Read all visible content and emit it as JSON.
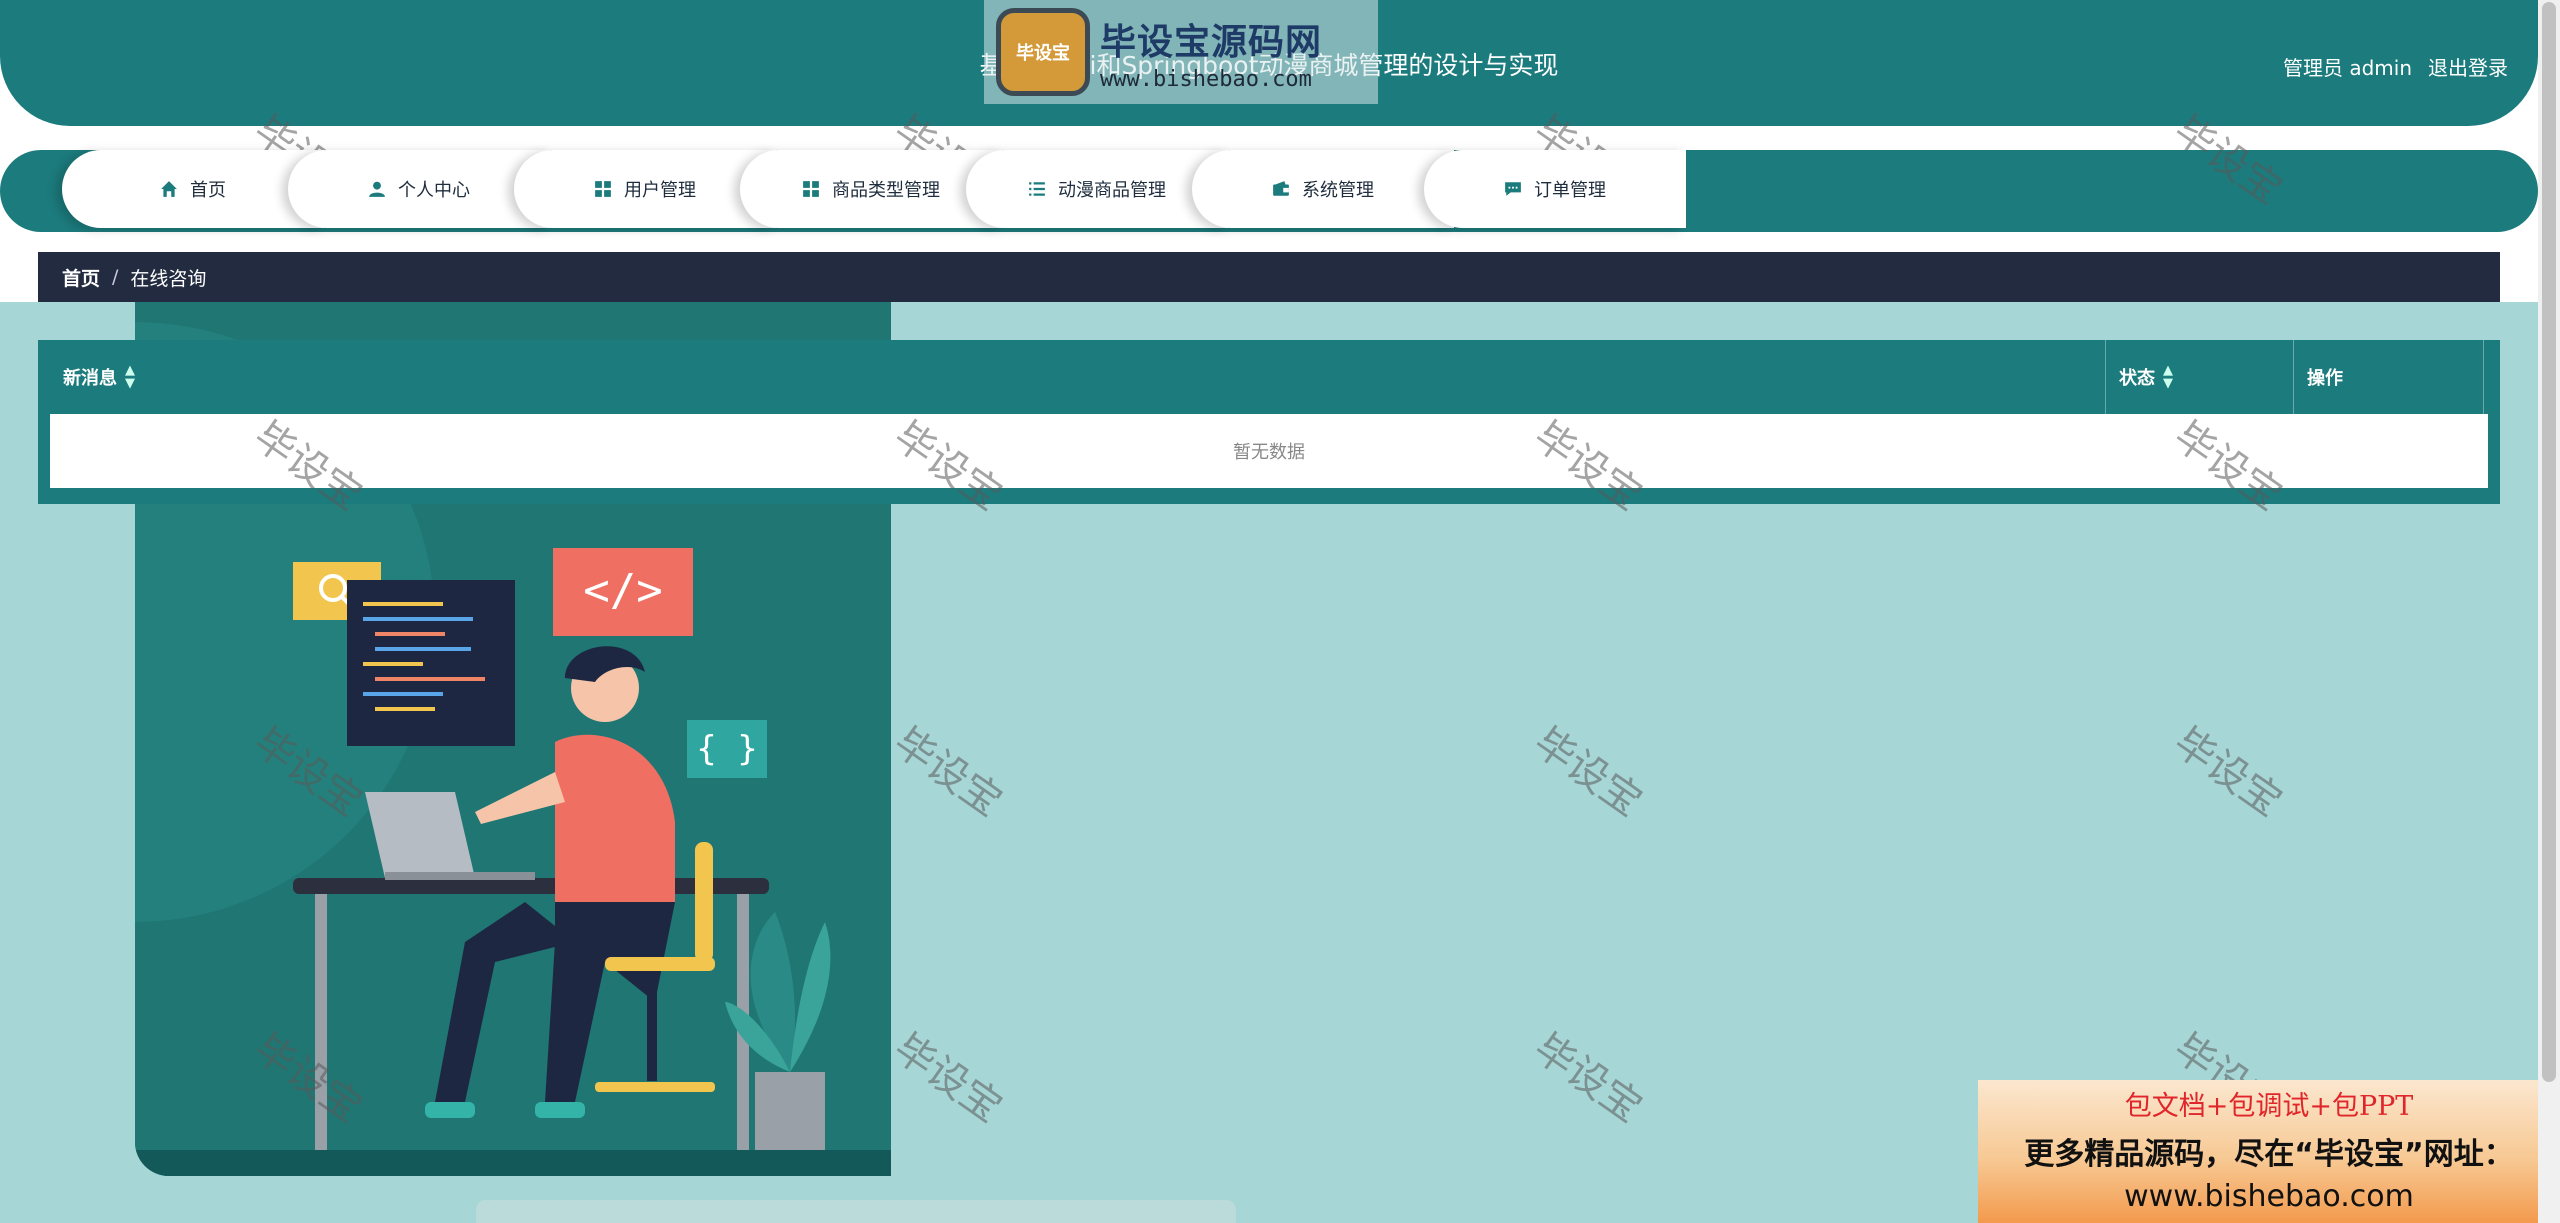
{
  "header": {
    "title": "基于Layui和Springboot动漫商城管理的设计与实现",
    "user_label": "管理员 admin",
    "logout_label": "退出登录"
  },
  "logo": {
    "badge_text": "毕设宝",
    "name": "毕设宝源码网",
    "url": "www.bishebao.com"
  },
  "nav": {
    "items": [
      {
        "label": "首页",
        "icon": "home-icon"
      },
      {
        "label": "个人中心",
        "icon": "user-icon"
      },
      {
        "label": "用户管理",
        "icon": "grid-icon"
      },
      {
        "label": "商品类型管理",
        "icon": "grid-icon"
      },
      {
        "label": "动漫商品管理",
        "icon": "list-icon"
      },
      {
        "label": "系统管理",
        "icon": "wallet-icon"
      },
      {
        "label": "订单管理",
        "icon": "chat-icon"
      }
    ]
  },
  "breadcrumb": {
    "home": "首页",
    "separator": "/",
    "current": "在线咨询"
  },
  "table": {
    "columns": [
      {
        "label": "新消息",
        "sortable": true
      },
      {
        "label": "状态",
        "sortable": true
      },
      {
        "label": "操作",
        "sortable": false
      }
    ],
    "empty_text": "暂无数据"
  },
  "watermark": {
    "text": "毕设宝"
  },
  "promo": {
    "line1": "包文档+包调试+包PPT",
    "line2": "更多精品源码，尽在“毕设宝”网址：",
    "line3": "www.bishebao.com"
  },
  "colors": {
    "primary": "#1c7b7d",
    "breadcrumb_bg": "#222b40",
    "content_bg": "#a7d6d6"
  }
}
